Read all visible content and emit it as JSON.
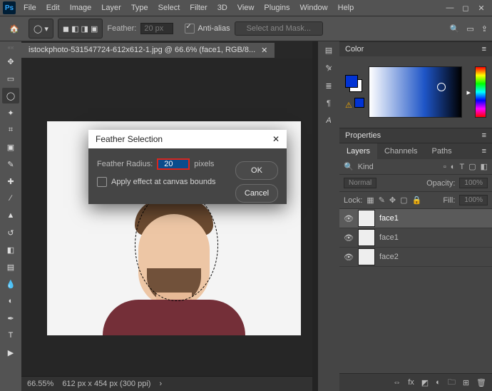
{
  "app_badge": "Ps",
  "menu": [
    "File",
    "Edit",
    "Image",
    "Layer",
    "Type",
    "Select",
    "Filter",
    "3D",
    "View",
    "Plugins",
    "Window",
    "Help"
  ],
  "toolbar": {
    "feather_label": "Feather:",
    "feather_value": "20 px",
    "anti_alias_label": "Anti-alias",
    "select_mask": "Select and Mask..."
  },
  "document": {
    "tab_title": "istockphoto-531547724-612x612-1.jpg @ 66.6% (face1, RGB/8...",
    "zoom": "66.55%",
    "dims": "612 px x 454 px (300 ppi)"
  },
  "dialog": {
    "title": "Feather Selection",
    "radius_label": "Feather Radius:",
    "radius_value": "20",
    "pixels_label": "pixels",
    "apply_label": "Apply effect at canvas bounds",
    "ok": "OK",
    "cancel": "Cancel"
  },
  "panels": {
    "color_tab": "Color",
    "properties_tab": "Properties",
    "layers_tabs": {
      "layers": "Layers",
      "channels": "Channels",
      "paths": "Paths"
    },
    "layer_search_placeholder": "Kind",
    "blend_mode": "Normal",
    "opacity_label": "Opacity:",
    "opacity_value": "100%",
    "lock_label": "Lock:",
    "fill_label": "Fill:",
    "fill_value": "100%",
    "layers": [
      {
        "name": "face1"
      },
      {
        "name": "face1"
      },
      {
        "name": "face2"
      }
    ]
  }
}
